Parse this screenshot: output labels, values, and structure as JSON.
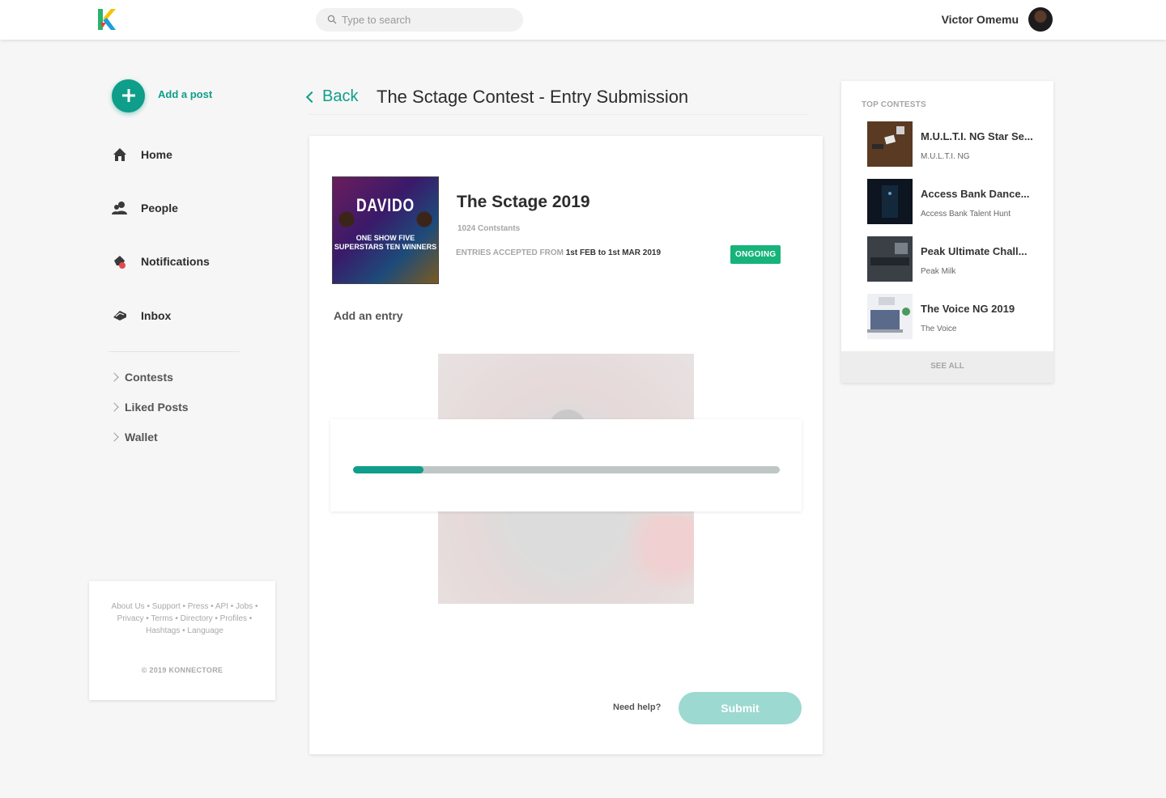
{
  "header": {
    "logo_letter": "K",
    "search_placeholder": "Type to search",
    "user_name": "Victor Omemu"
  },
  "sidebar": {
    "add_post_label": "Add a post",
    "nav": [
      {
        "label": "Home",
        "icon": "home-icon"
      },
      {
        "label": "People",
        "icon": "people-icon"
      },
      {
        "label": "Notifications",
        "icon": "bell-icon"
      },
      {
        "label": "Inbox",
        "icon": "inbox-icon"
      }
    ],
    "links": [
      {
        "label": "Contests"
      },
      {
        "label": "Liked Posts"
      },
      {
        "label": "Wallet"
      }
    ],
    "footer_links": "About Us • Support • Press • API • Jobs • Privacy • Terms • Directory • Profiles • Hashtags • Language",
    "copyright": "© 2019 KONNECTORE"
  },
  "main": {
    "back_label": "Back",
    "page_title": "The Sctage Contest - Entry Submission",
    "contest": {
      "poster_title": "DAVIDO",
      "poster_subtitle": "ONE SHOW FIVE SUPERSTARS TEN WINNERS",
      "name": "The Sctage 2019",
      "contestants": "1024 Contstants",
      "entries_prefix": "ENTRIES ACCEPTED FROM",
      "entries_dates": "1st FEB to 1st MAR 2019",
      "status": "ONGOING"
    },
    "add_entry_label": "Add an entry",
    "upload_progress": 0.165,
    "need_help": "Need help?",
    "submit_label": "Submit"
  },
  "rail": {
    "heading": "TOP CONTESTS",
    "items": [
      {
        "title": "M.U.L.T.I. NG Star Se...",
        "sub": "M.U.L.T.I. NG"
      },
      {
        "title": "Access Bank Dance...",
        "sub": "Access Bank Talent Hunt"
      },
      {
        "title": "Peak Ultimate Chall...",
        "sub": "Peak Milk"
      },
      {
        "title": "The Voice NG 2019",
        "sub": "The Voice"
      }
    ],
    "see_all": "SEE ALL"
  },
  "colors": {
    "accent": "#0e9e8a",
    "badge": "#16b37a",
    "submit_disabled": "#9cd9d1"
  }
}
